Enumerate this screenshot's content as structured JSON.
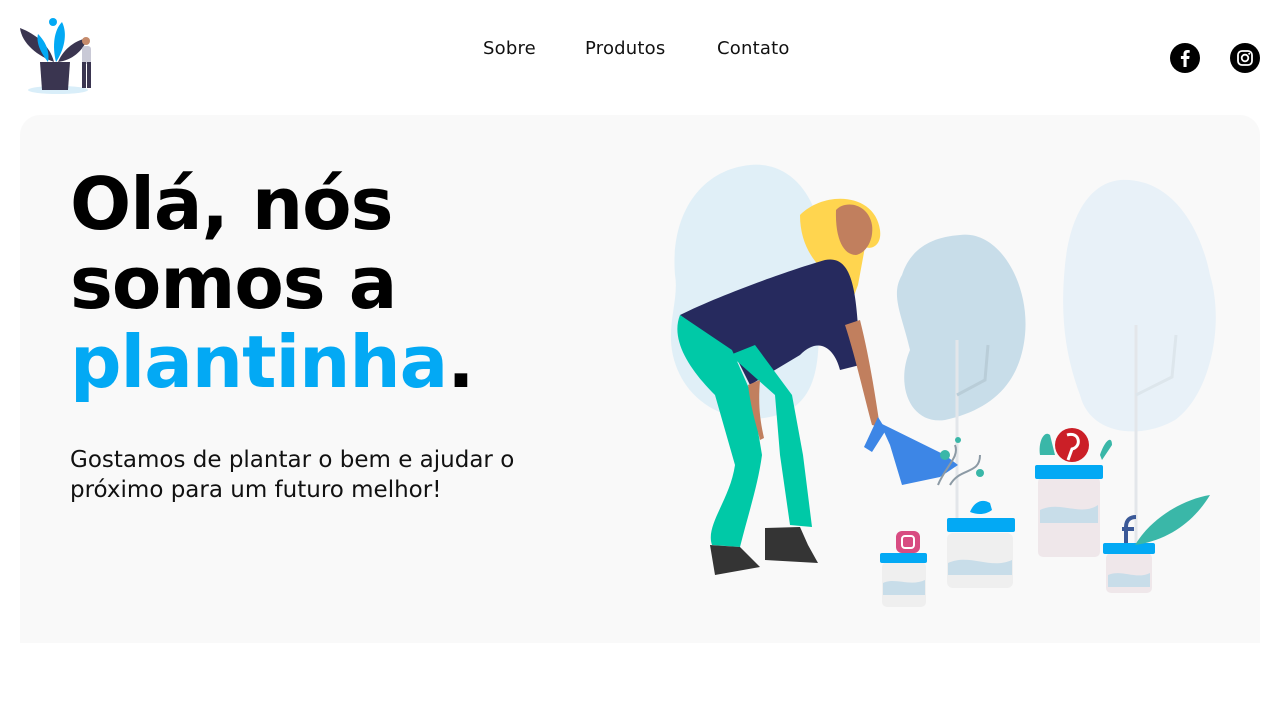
{
  "nav": {
    "items": [
      {
        "label": "Sobre"
      },
      {
        "label": "Produtos"
      },
      {
        "label": "Contato"
      }
    ]
  },
  "social": [
    {
      "icon": "facebook-icon"
    },
    {
      "icon": "instagram-icon"
    }
  ],
  "hero": {
    "line1": "Olá, nós",
    "line2": "somos a",
    "brand": "plantinha",
    "period": ".",
    "subtitle": "Gostamos de plantar o bem e ajudar o próximo para um futuro melhor!"
  },
  "colors": {
    "accent": "#03a9f4",
    "hero_bg": "#f9f9f9",
    "text": "#000000"
  }
}
